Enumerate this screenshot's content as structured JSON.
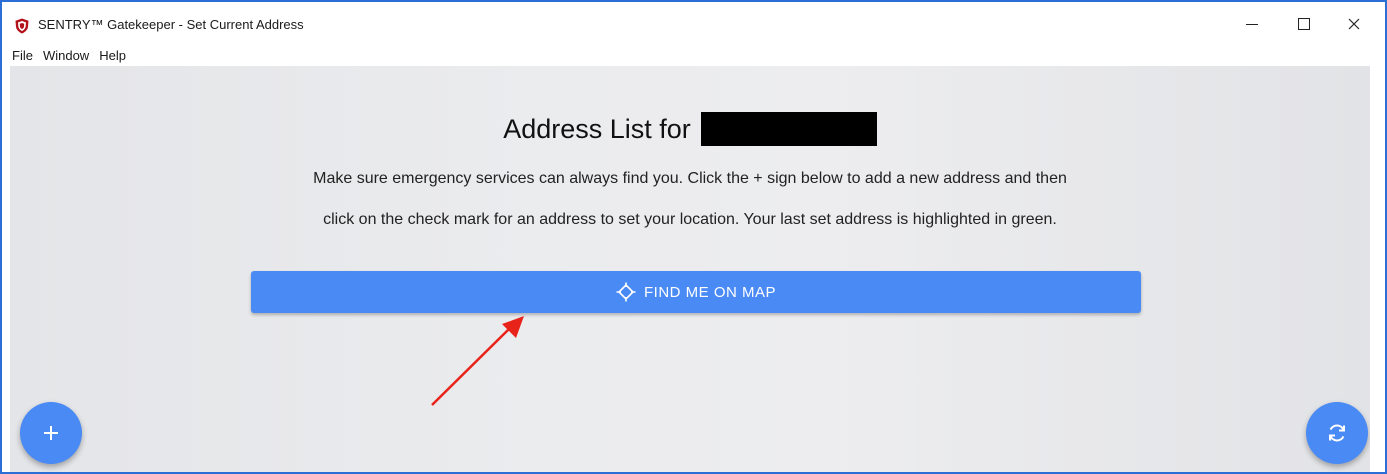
{
  "window": {
    "title": "SENTRY™ Gatekeeper - Set Current Address"
  },
  "menu": {
    "items": [
      "File",
      "Window",
      "Help"
    ]
  },
  "main": {
    "heading": "Address List for",
    "description_line1": "Make sure emergency services can always find you. Click the + sign below to add a new address and then",
    "description_line2": "click on the check mark for an address to set your location. Your last set address is highlighted in green.",
    "find_button_label": "FIND ME ON MAP"
  },
  "icons": {
    "app": "shield-icon",
    "find": "crosshair-icon",
    "add": "plus-icon",
    "refresh": "refresh-icon"
  },
  "colors": {
    "accent": "#4a8af4",
    "window_border": "#2b6fd6",
    "annotation_arrow": "#e8231a"
  }
}
